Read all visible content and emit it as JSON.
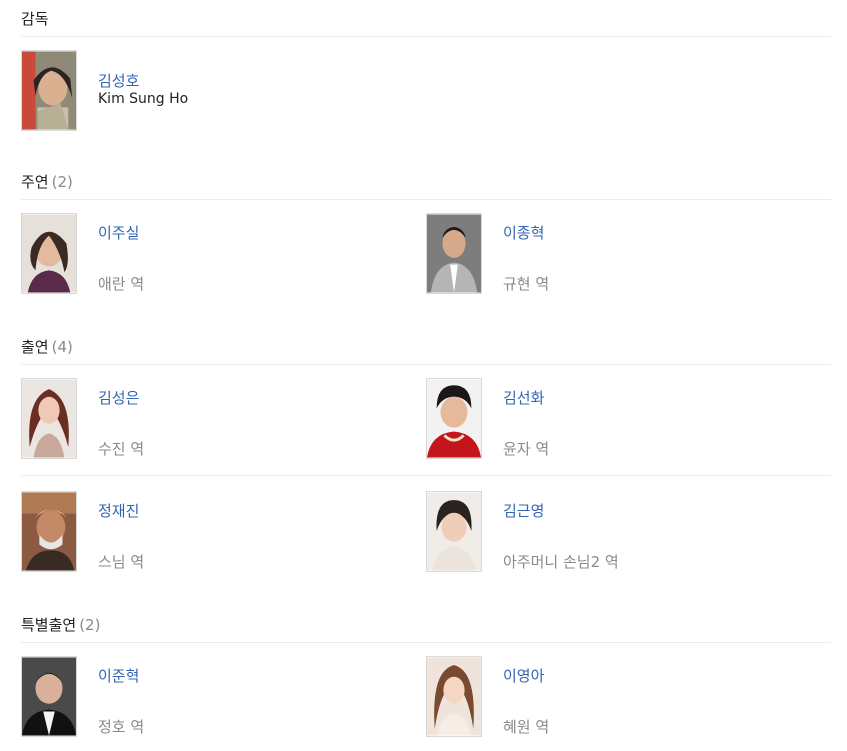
{
  "director": {
    "heading": "감독",
    "name": "김성호",
    "english_name": "Kim Sung Ho"
  },
  "lead": {
    "heading": "주연",
    "count": "(2)",
    "people": [
      {
        "name": "이주실",
        "role": "애란 역"
      },
      {
        "name": "이종혁",
        "role": "규현 역"
      }
    ]
  },
  "supporting": {
    "heading": "출연",
    "count": "(4)",
    "people": [
      {
        "name": "김성은",
        "role": "수진 역"
      },
      {
        "name": "김선화",
        "role": "윤자 역"
      },
      {
        "name": "정재진",
        "role": "스님 역"
      },
      {
        "name": "김근영",
        "role": "아주머니 손님2 역"
      }
    ]
  },
  "special": {
    "heading": "특별출연",
    "count": "(2)",
    "people": [
      {
        "name": "이준혁",
        "role": "정호 역"
      },
      {
        "name": "이영아",
        "role": "혜원 역"
      }
    ]
  }
}
